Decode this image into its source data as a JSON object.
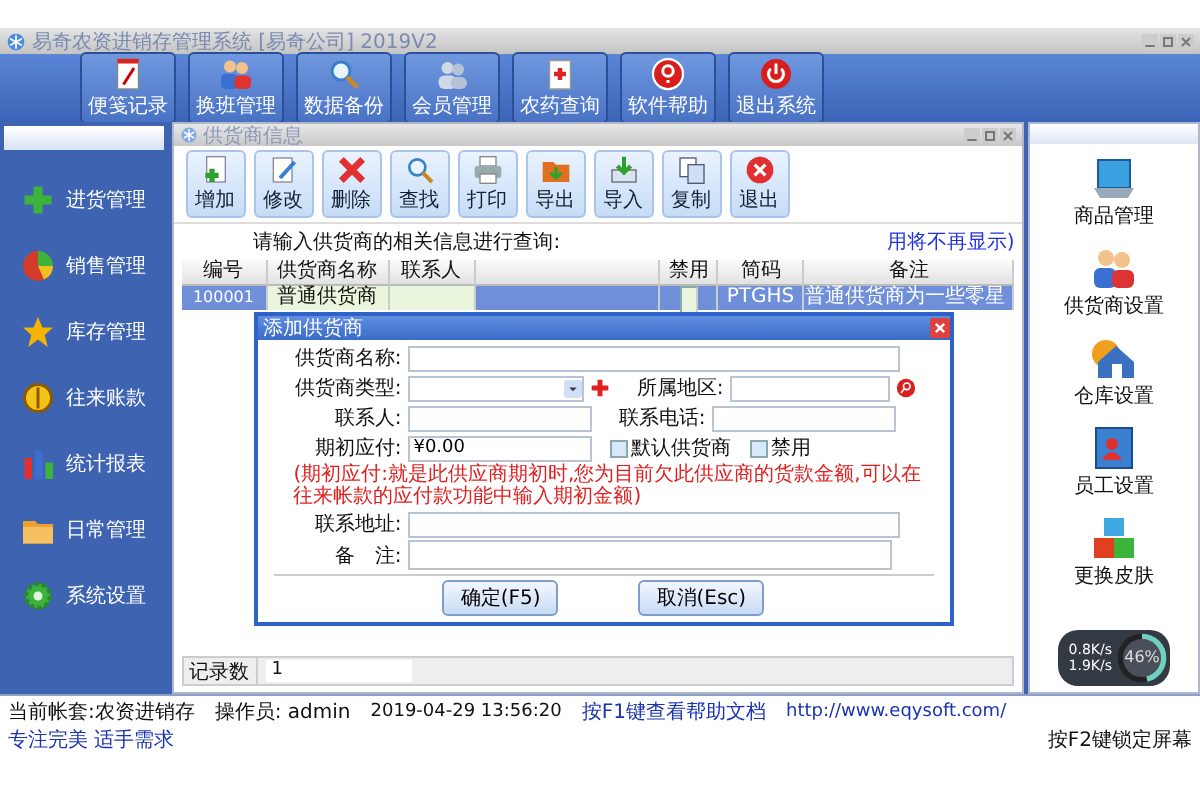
{
  "window": {
    "title": "易奇农资进销存管理系统 [易奇公司] 2019V2"
  },
  "toolbar": [
    {
      "label": "便笺记录"
    },
    {
      "label": "换班管理"
    },
    {
      "label": "数据备份"
    },
    {
      "label": "会员管理"
    },
    {
      "label": "农药查询"
    },
    {
      "label": "软件帮助"
    },
    {
      "label": "退出系统"
    }
  ],
  "sidebar": {
    "items": [
      {
        "label": "进货管理"
      },
      {
        "label": "销售管理"
      },
      {
        "label": "库存管理"
      },
      {
        "label": "往来账款"
      },
      {
        "label": "统计报表"
      },
      {
        "label": "日常管理"
      },
      {
        "label": "系统设置"
      }
    ]
  },
  "supplier_window": {
    "title": "供货商信息",
    "toolbar": [
      {
        "label": "增加"
      },
      {
        "label": "修改"
      },
      {
        "label": "删除"
      },
      {
        "label": "查找"
      },
      {
        "label": "打印"
      },
      {
        "label": "导出"
      },
      {
        "label": "导入"
      },
      {
        "label": "复制"
      },
      {
        "label": "退出"
      }
    ],
    "prompt": "请输入供货商的相关信息进行查询:",
    "hint_link": "用将不再显示)",
    "table": {
      "columns": [
        "编号",
        "供货商名称",
        "联系人",
        "禁用",
        "简码",
        "备注"
      ],
      "rows": [
        {
          "selected": true,
          "cells": [
            "100001",
            "普通供货商",
            "",
            null,
            "PTGHS",
            "普通供货商为一些零星"
          ],
          "disabled": false
        }
      ]
    },
    "footer": {
      "label": "记录数",
      "value": "1"
    }
  },
  "dialog": {
    "title": "添加供货商",
    "fields": [
      {
        "label": "供货商名称:"
      },
      {
        "label": "供货商类型:"
      },
      {
        "label": "所属地区:"
      },
      {
        "label": "联系人:"
      },
      {
        "label": "联系电话:"
      },
      {
        "label": "期初应付:",
        "value": "¥0.00"
      }
    ],
    "checkboxes": [
      {
        "label": "默认供货商",
        "checked": false
      },
      {
        "label": "禁用",
        "checked": false
      }
    ],
    "note": "(期初应付:就是此供应商期初时,您为目前欠此供应商的货款金额,可以在往来帐款的应付款功能中输入期初金额)",
    "address": {
      "label": "联系地址:"
    },
    "remark": {
      "label": "备　注:"
    },
    "buttons": [
      "确定(F5)",
      "取消(Esc)"
    ]
  },
  "right_panel": {
    "items": [
      {
        "label": "商品管理"
      },
      {
        "label": "供货商设置"
      },
      {
        "label": "仓库设置"
      },
      {
        "label": "员工设置"
      },
      {
        "label": "更换皮肤"
      }
    ]
  },
  "net_widget": {
    "upload": "0.8K/s",
    "download": "1.9K/s",
    "percent": "46%",
    "level": 0.46
  },
  "status_bar": {
    "account": "当前帐套:农资进销存",
    "operator": "操作员: admin",
    "time": "2019-04-29 13:56:20",
    "help": "按F1键查看帮助文档",
    "url": "http://www.eqysoft.com/",
    "slogan": "专注完美 适手需求",
    "lock": "按F2键锁定屏幕"
  }
}
